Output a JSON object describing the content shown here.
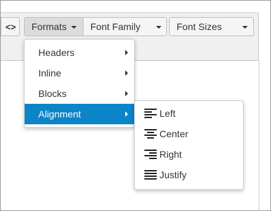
{
  "toolbar": {
    "code_label": "<>",
    "formats_label": "Formats",
    "font_family_label": "Font Family",
    "font_sizes_label": "Font Sizes"
  },
  "formats_menu": {
    "items": [
      {
        "label": "Headers"
      },
      {
        "label": "Inline"
      },
      {
        "label": "Blocks"
      },
      {
        "label": "Alignment",
        "active": true
      }
    ]
  },
  "alignment_menu": {
    "items": [
      {
        "label": "Left",
        "icon": "align-left-icon"
      },
      {
        "label": "Center",
        "icon": "align-center-icon"
      },
      {
        "label": "Right",
        "icon": "align-right-icon"
      },
      {
        "label": "Justify",
        "icon": "align-justify-icon"
      }
    ]
  },
  "colors": {
    "accent": "#0b84c8"
  }
}
